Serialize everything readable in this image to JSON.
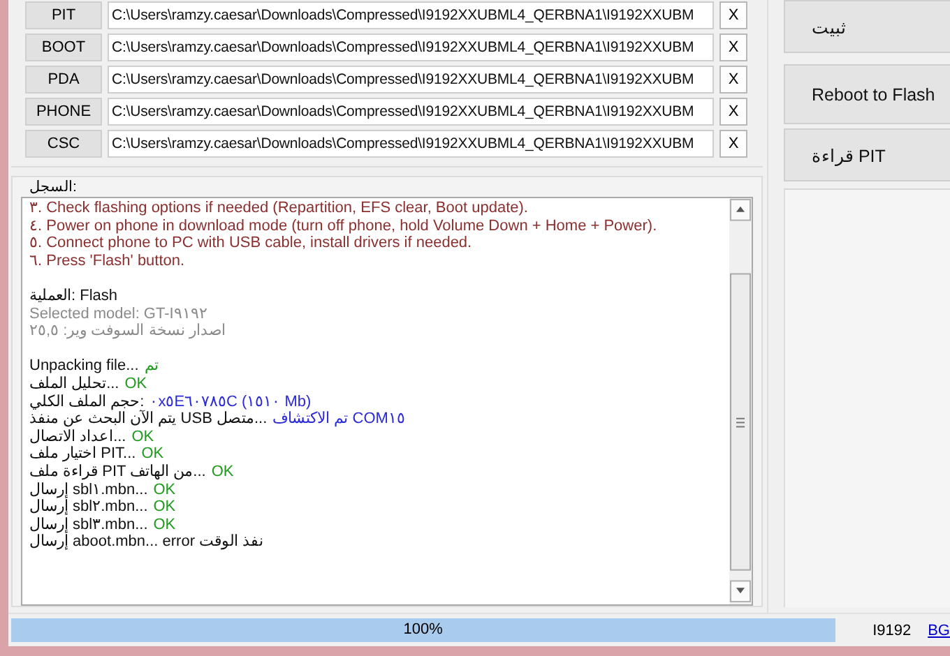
{
  "files": [
    {
      "label": "PIT",
      "path": "C:\\Users\\ramzy.caesar\\Downloads\\Compressed\\I9192XXUBML4_QERBNA1\\I9192XXUBM",
      "clear": "X"
    },
    {
      "label": "BOOT",
      "path": "C:\\Users\\ramzy.caesar\\Downloads\\Compressed\\I9192XXUBML4_QERBNA1\\I9192XXUBM",
      "clear": "X"
    },
    {
      "label": "PDA",
      "path": "C:\\Users\\ramzy.caesar\\Downloads\\Compressed\\I9192XXUBML4_QERBNA1\\I9192XXUBM",
      "clear": "X"
    },
    {
      "label": "PHONE",
      "path": "C:\\Users\\ramzy.caesar\\Downloads\\Compressed\\I9192XXUBML4_QERBNA1\\I9192XXUBM",
      "clear": "X"
    },
    {
      "label": "CSC",
      "path": "C:\\Users\\ramzy.caesar\\Downloads\\Compressed\\I9192XXUBML4_QERBNA1\\I9192XXUBM",
      "clear": "X"
    }
  ],
  "actions": [
    {
      "label": "ثبيت"
    },
    {
      "label": "Reboot to Flash"
    },
    {
      "label": "قراءة PIT"
    }
  ],
  "log": {
    "title": "السجل:",
    "blocks": [
      {
        "lines": [
          {
            "kind": "instruction",
            "text": "٣. Check flashing options if needed (Repartition, EFS clear, Boot update)."
          },
          {
            "kind": "instruction",
            "text": "٤. Power on phone in download mode (turn off phone, hold Volume Down + Home + Power)."
          },
          {
            "kind": "instruction",
            "text": "٥. Connect phone to PC with USB cable, install drivers if needed."
          },
          {
            "kind": "instruction",
            "text": "٦. Press 'Flash' button."
          }
        ]
      },
      {
        "lines": [
          {
            "kind": "plain",
            "text": "العملية: Flash"
          },
          {
            "kind": "muted",
            "text": "Selected model: GT-I٩١٩٢"
          },
          {
            "kind": "muted",
            "text": "اصدار نسخة السوفت وير: ٢٥,٥"
          }
        ]
      },
      {
        "lines": [
          {
            "kind": "plain",
            "text": "Unpacking file...",
            "result": {
              "kind": "ok",
              "text": "تم"
            }
          },
          {
            "kind": "plain",
            "text": "تحليل الملف...",
            "result": {
              "kind": "ok",
              "text": "OK"
            }
          },
          {
            "kind": "plain",
            "text": "حجم الملف الكلي:",
            "result": {
              "kind": "info",
              "text": "٠x٥E٦٠٧٨٥C (١٥١٠ Mb)"
            }
          },
          {
            "kind": "plain",
            "text": "يتم الآن البحث عن منفذ USB متصل...",
            "result": {
              "kind": "info",
              "text": "تم الاكتشاف COM١٥"
            }
          },
          {
            "kind": "plain",
            "text": "اعداد الاتصال...",
            "result": {
              "kind": "ok",
              "text": "OK"
            }
          },
          {
            "kind": "plain",
            "text": "اختيار ملف PIT...",
            "result": {
              "kind": "ok",
              "text": "OK"
            }
          },
          {
            "kind": "plain",
            "text": "قراءة ملف PIT من الهاتف...",
            "result": {
              "kind": "ok",
              "text": "OK"
            }
          },
          {
            "kind": "plain",
            "text": "إرسال sbl١.mbn...",
            "result": {
              "kind": "ok",
              "text": "OK"
            }
          },
          {
            "kind": "plain",
            "text": "إرسال sbl٢.mbn...",
            "result": {
              "kind": "ok",
              "text": "OK"
            }
          },
          {
            "kind": "plain",
            "text": "إرسال sbl٣.mbn...",
            "result": {
              "kind": "ok",
              "text": "OK"
            }
          },
          {
            "kind": "plain",
            "text": "إرسال aboot.mbn... error نفذ الوقت"
          }
        ]
      }
    ]
  },
  "status_bar": {
    "progress": {
      "level": 1,
      "text": "100%"
    },
    "model": "I9192",
    "link": "BG"
  }
}
